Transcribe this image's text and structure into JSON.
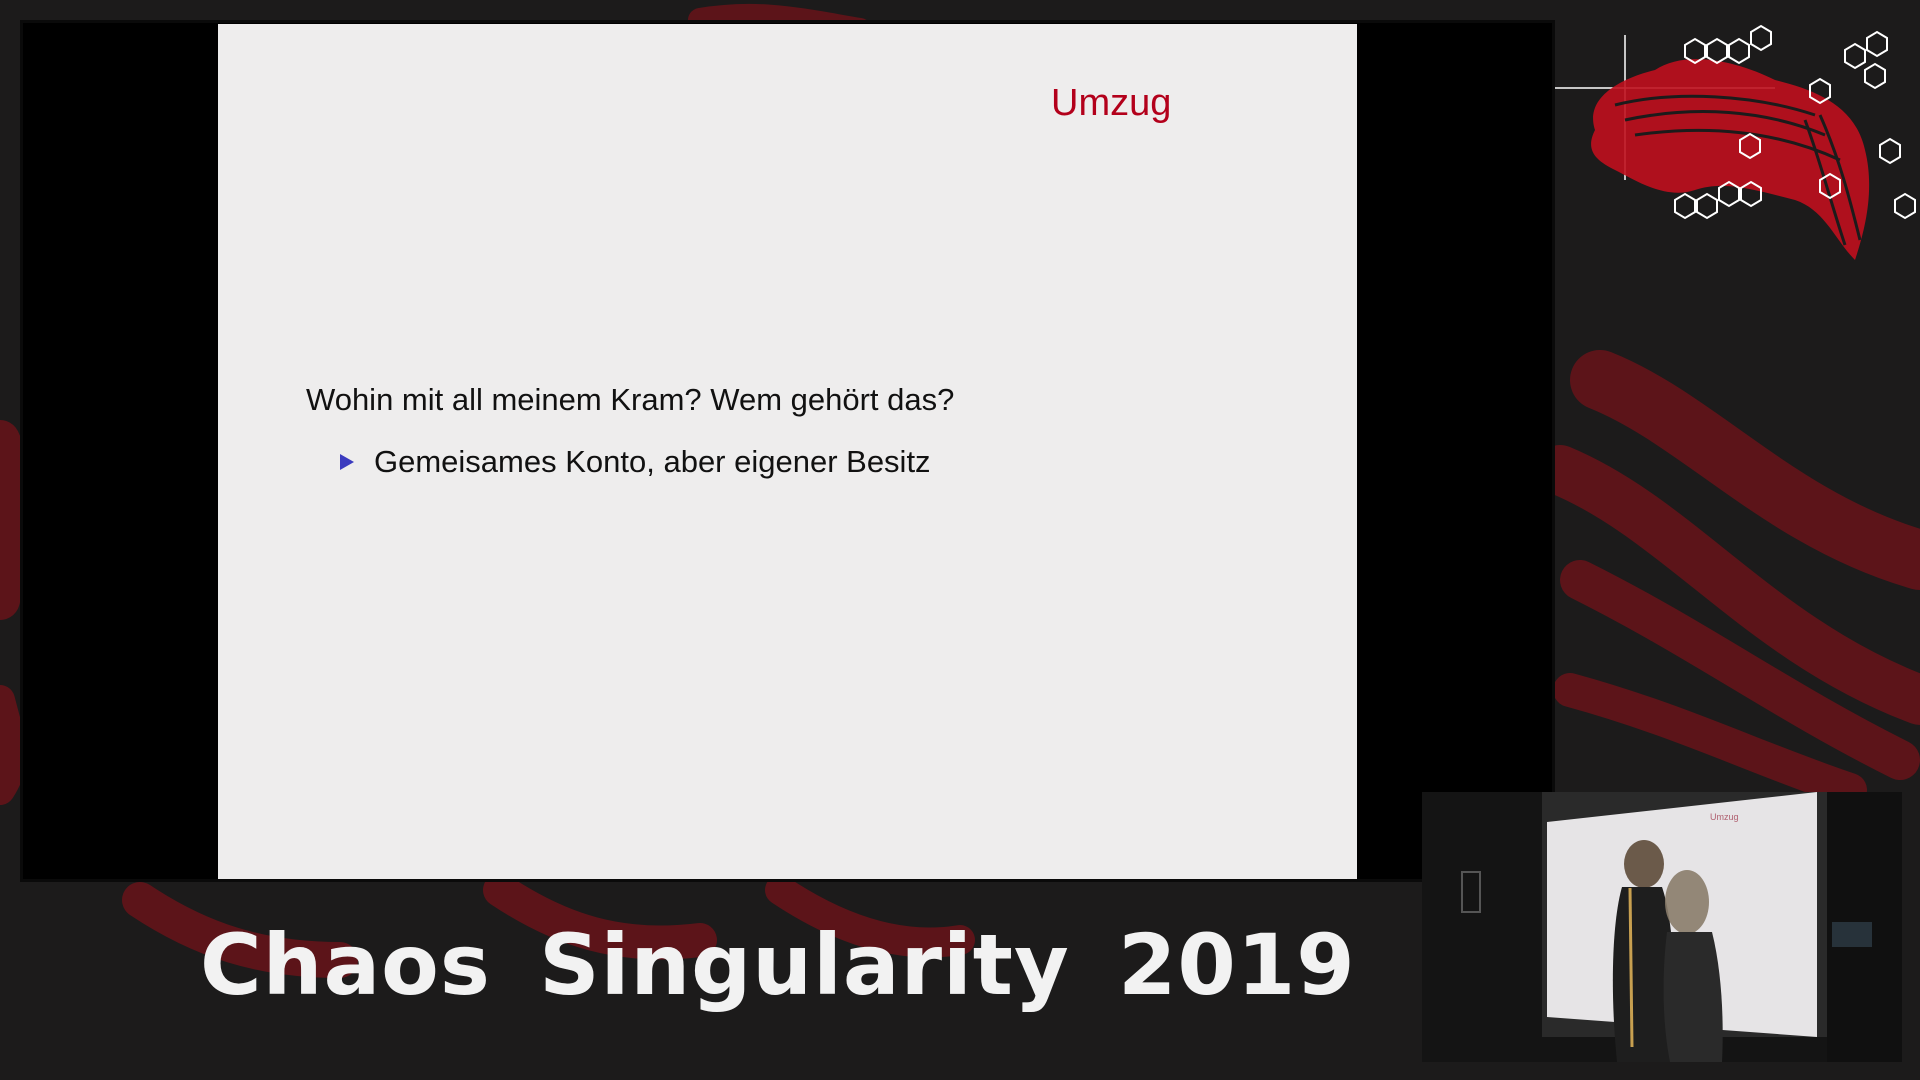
{
  "slide": {
    "title": "Umzug",
    "question": "Wohin mit all meinem Kram? Wem gehört das?",
    "bullets": [
      "Gemeisames Konto, aber eigener Besitz"
    ]
  },
  "event": {
    "name": "Chaos Singularity 2019"
  },
  "camera": {
    "projected_title": "Umzug"
  },
  "colors": {
    "accent_red": "#b3001b",
    "bullet_blue": "#3b3bbf",
    "background": "#1c1b1b",
    "slide_background": "#eeeded"
  },
  "icons": {
    "bullet": "triangle-bullet-icon",
    "logo": "swiss-map-hexagon-logo-icon"
  }
}
